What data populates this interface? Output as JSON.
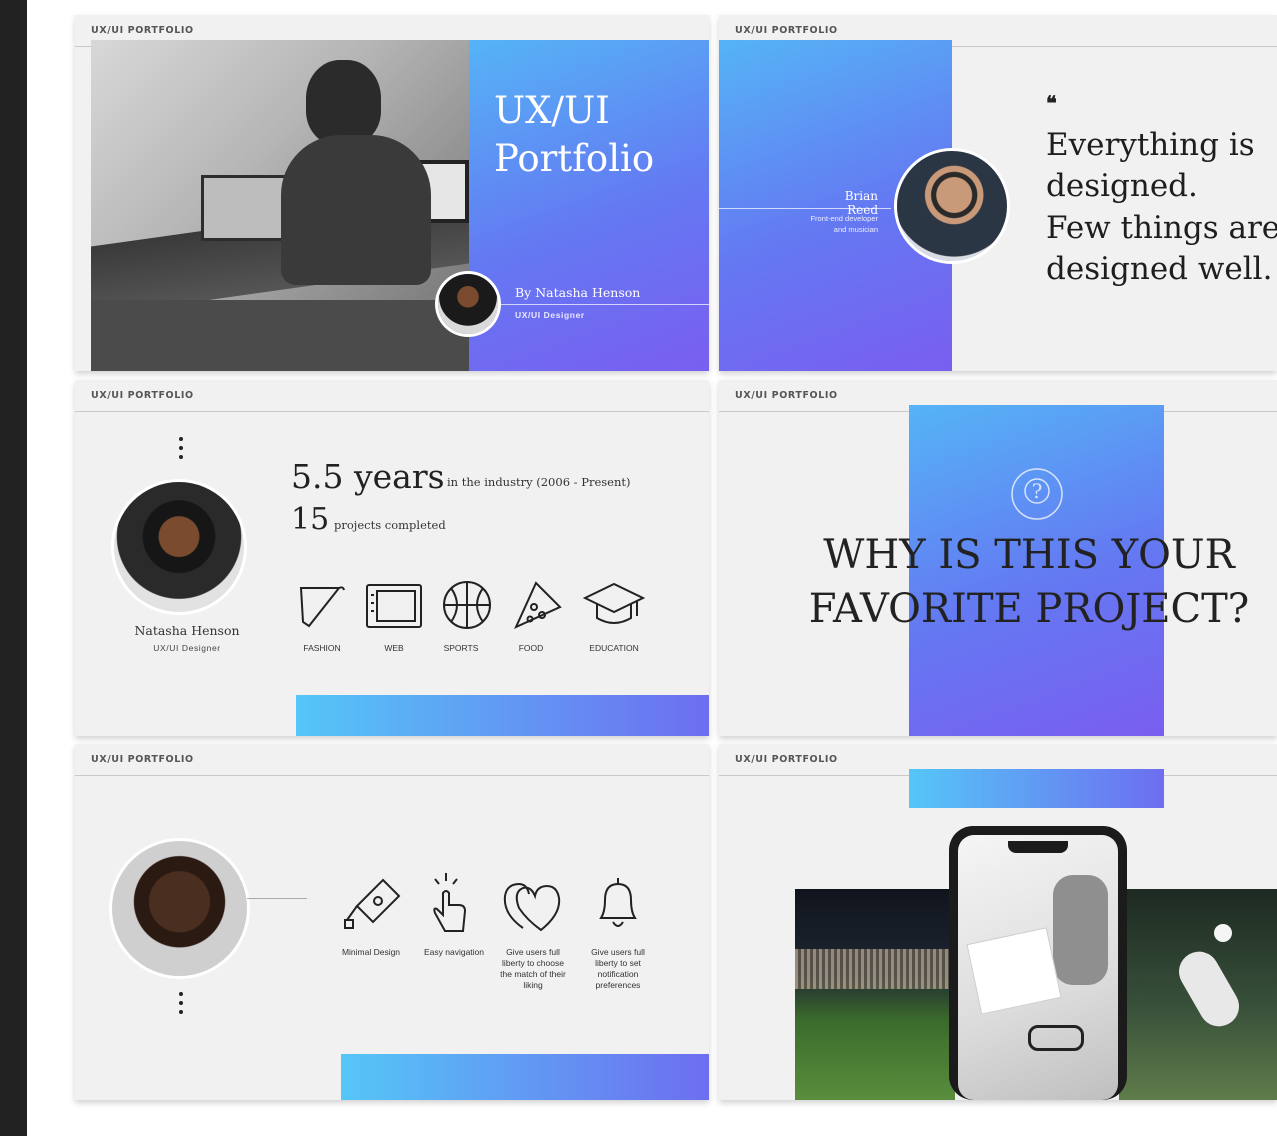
{
  "header_label": "UX/UI PORTFOLIO",
  "colors": {
    "gradient_start": "#55b4f6",
    "gradient_end": "#7a5ef0",
    "slide_bg": "#f1f1f1"
  },
  "slide1": {
    "title_line1": "UX/UI",
    "title_line2": "Portfolio",
    "by": "By Natasha Henson",
    "role": "UX/UI Designer"
  },
  "slide2": {
    "name": "Brian Reed",
    "role_line1": "Front-end developer",
    "role_line2": "and musician",
    "quote_mark": "❝",
    "quote_lines": [
      "Everything is",
      "designed.",
      "Few things are",
      "designed well."
    ]
  },
  "slide3": {
    "years_value": "5.5 years",
    "years_caption": "in the industry (2006 - Present)",
    "projects_value": "15",
    "projects_caption": "projects completed",
    "name": "Natasha Henson",
    "role": "UX/UI Designer",
    "categories": [
      {
        "label": "FASHION",
        "icon": "hanger-icon"
      },
      {
        "label": "WEB",
        "icon": "tablet-icon"
      },
      {
        "label": "SPORTS",
        "icon": "basketball-icon"
      },
      {
        "label": "FOOD",
        "icon": "pizza-icon"
      },
      {
        "label": "EDUCATION",
        "icon": "graduation-cap-icon"
      }
    ]
  },
  "slide4": {
    "question_line1": "WHY IS THIS YOUR",
    "question_line2": "FAVORITE PROJECT?",
    "icon": "question-icon"
  },
  "slide5": {
    "features": [
      {
        "label": "Minimal Design",
        "icon": "pen-tool-icon"
      },
      {
        "label": "Easy navigation",
        "icon": "pointer-hand-icon"
      },
      {
        "label": "Give users full liberty to choose the match of their liking",
        "icon": "hearts-icon"
      },
      {
        "label": "Give users full liberty to set notification preferences",
        "icon": "bell-icon"
      }
    ]
  },
  "slide6": {
    "images": [
      "stadium-photo",
      "phone-mockup",
      "soccer-player-photo"
    ]
  }
}
